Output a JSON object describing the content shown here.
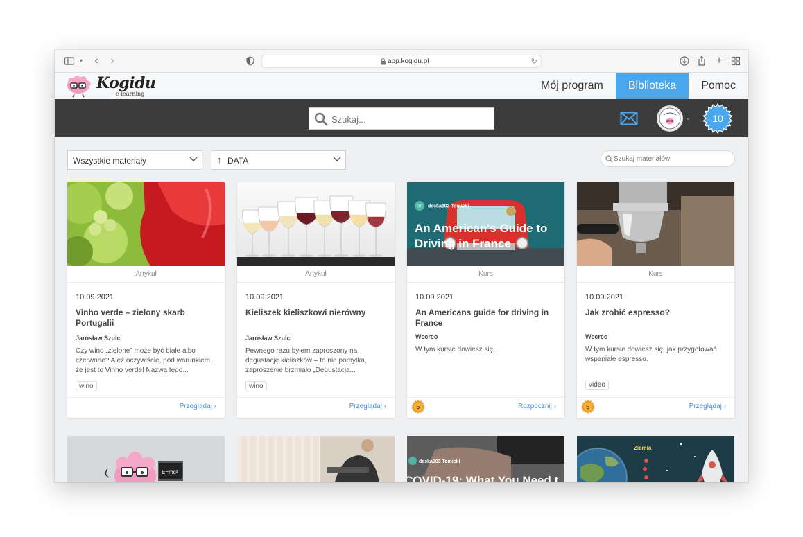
{
  "browser": {
    "url": "app.kogidu.pl"
  },
  "app": {
    "logo_text": "Kogidu",
    "logo_sub": "e-learning",
    "nav": [
      {
        "label": "Mój program",
        "active": false
      },
      {
        "label": "Biblioteka",
        "active": true
      },
      {
        "label": "Pomoc",
        "active": false
      }
    ],
    "search_placeholder": "Szukaj...",
    "badge_count": "10",
    "accent_color": "#4aa7ec"
  },
  "filters": {
    "type_select": "Wszystkie materiały",
    "sort_select": "DATA",
    "search_placeholder": "Szukaj materiałów"
  },
  "cards": [
    {
      "type": "Artykuł",
      "date": "10.09.2021",
      "title": "Vinho verde – zielony skarb Portugalii",
      "author": "Jarosław Szulc",
      "description": "Czy wino „zielone” może być białe albo czerwone? Ależ oczywiście, pod warunkiem, że jest to Vinho verde! Nazwa tego...",
      "tag": "wino",
      "action": "Przeglądaj",
      "points": ""
    },
    {
      "type": "Artykuł",
      "date": "10.09.2021",
      "title": "Kieliszek kieliszkowi nierówny",
      "author": "Jarosław Szulc",
      "description": "Pewnego razu byłem zaproszony na degustację kieliszków – to nie pomyłka, zaproszenie brzmiało „Degustacja...",
      "tag": "wino",
      "action": "Przeglądaj",
      "points": ""
    },
    {
      "type": "Kurs",
      "date": "10.09.2021",
      "title": "An Americans guide for driving in France",
      "author": "Wecreo",
      "description": "W tym kursie dowiesz się...",
      "tag": "",
      "action": "Rozpocznij",
      "points": "5",
      "thumb_title": "An American's Guide to Driving in France",
      "thumb_author": "deska303 Tomicki",
      "thumb_initials": "DT"
    },
    {
      "type": "Kurs",
      "date": "10.09.2021",
      "title": "Jak zrobić espresso?",
      "author": "Wecreo",
      "description": "W tym kursie dowiesz się, jak przygotować wspaniałe espresso.",
      "tag": "video",
      "action": "Przeglądaj",
      "points": "5"
    }
  ],
  "row2": {
    "card3_author": "deska303 Tomicki",
    "card3_title": "COVID-19: What You Need t",
    "card4_label": "Ziemia",
    "card1_formula": "E=mc²"
  }
}
